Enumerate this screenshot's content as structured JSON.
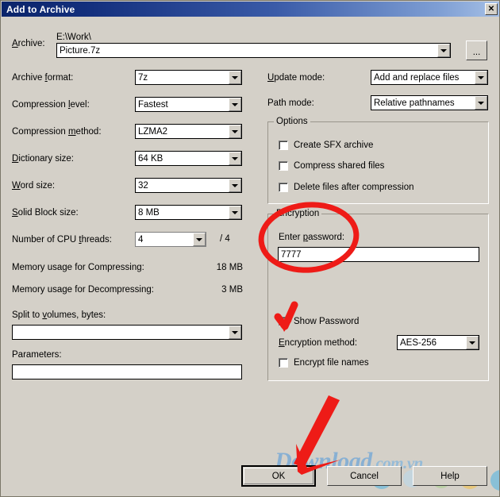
{
  "window": {
    "title": "Add to Archive",
    "close_label": "✕"
  },
  "archive": {
    "label": "Archive:",
    "path_text": "E:\\Work\\",
    "filename_value": "Picture.7z",
    "browse_label": "..."
  },
  "left_fields": [
    {
      "label": "Archive format:",
      "value": "7z"
    },
    {
      "label": "Compression level:",
      "value": "Fastest"
    },
    {
      "label": "Compression method:",
      "value": "LZMA2"
    },
    {
      "label": "Dictionary size:",
      "value": "64 KB"
    },
    {
      "label": "Word size:",
      "value": "32"
    },
    {
      "label": "Solid Block size:",
      "value": "8 MB"
    }
  ],
  "cpu_threads": {
    "label": "Number of CPU threads:",
    "value": "4",
    "total": "/ 4"
  },
  "memory": {
    "compress_label": "Memory usage for Compressing:",
    "compress_value": "18 MB",
    "decompress_label": "Memory usage for Decompressing:",
    "decompress_value": "3 MB"
  },
  "split": {
    "label": "Split to volumes, bytes:",
    "value": ""
  },
  "parameters": {
    "label": "Parameters:",
    "value": ""
  },
  "right_fields": [
    {
      "label": "Update mode:",
      "value": "Add and replace files"
    },
    {
      "label": "Path mode:",
      "value": "Relative pathnames"
    }
  ],
  "options": {
    "legend": "Options",
    "items": [
      {
        "label": "Create SFX archive",
        "checked": false
      },
      {
        "label": "Compress shared files",
        "checked": false
      },
      {
        "label": "Delete files after compression",
        "checked": false
      }
    ]
  },
  "encryption": {
    "legend": "Encryption",
    "password_label": "Enter password:",
    "password_value": "7777",
    "show_password_label": "Show Password",
    "show_password_checked": true,
    "method_label": "Encryption method:",
    "method_value": "AES-256",
    "encrypt_names_label": "Encrypt file names",
    "encrypt_names_checked": false
  },
  "buttons": {
    "ok": "OK",
    "cancel": "Cancel",
    "help": "Help"
  },
  "watermark": {
    "main": "Download",
    "suffix": ".com.vn"
  },
  "colors": {
    "dialog_face": "#d4d0c8",
    "title_start": "#0a246a",
    "title_end": "#a6c0e6",
    "annotation_red": "#ee1b17",
    "watermark_blue": "#6ba4d8"
  }
}
